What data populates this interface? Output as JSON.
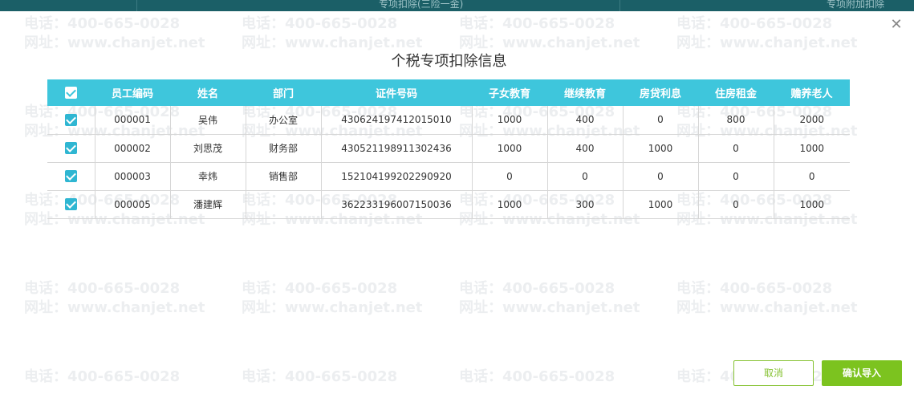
{
  "background": {
    "header_cells": [
      "专项扣除(三险一金)",
      "专项附加扣除"
    ]
  },
  "watermark": {
    "phone": "电话：400-665-0028",
    "site": "网址：www.chanjet.net"
  },
  "dialog": {
    "title": "个税专项扣除信息",
    "close_icon": "close-icon",
    "columns": [
      "员工编码",
      "姓名",
      "部门",
      "证件号码",
      "子女教育",
      "继续教育",
      "房贷利息",
      "住房租金",
      "赡养老人"
    ],
    "rows": [
      {
        "checked": true,
        "code": "000001",
        "name": "吴伟",
        "dept": "办公室",
        "id_no": "430624197412015010",
        "child_edu": "1000",
        "cont_edu": "400",
        "loan_interest": "0",
        "rent": "800",
        "elderly": "2000"
      },
      {
        "checked": true,
        "code": "000002",
        "name": "刘思茂",
        "dept": "财务部",
        "id_no": "430521198911302436",
        "child_edu": "1000",
        "cont_edu": "400",
        "loan_interest": "1000",
        "rent": "0",
        "elderly": "1000"
      },
      {
        "checked": true,
        "code": "000003",
        "name": "幸炜",
        "dept": "销售部",
        "id_no": "152104199202290920",
        "child_edu": "0",
        "cont_edu": "0",
        "loan_interest": "0",
        "rent": "0",
        "elderly": "0"
      },
      {
        "checked": true,
        "code": "000005",
        "name": "潘建辉",
        "dept": "",
        "id_no": "362233196007150036",
        "child_edu": "1000",
        "cont_edu": "300",
        "loan_interest": "1000",
        "rent": "0",
        "elderly": "1000"
      }
    ],
    "buttons": {
      "cancel": "取消",
      "confirm": "确认导入"
    }
  },
  "colors": {
    "header_bg": "#3ec6dc",
    "accent_green": "#7cc31f",
    "checkbox": "#2fb6d2"
  }
}
